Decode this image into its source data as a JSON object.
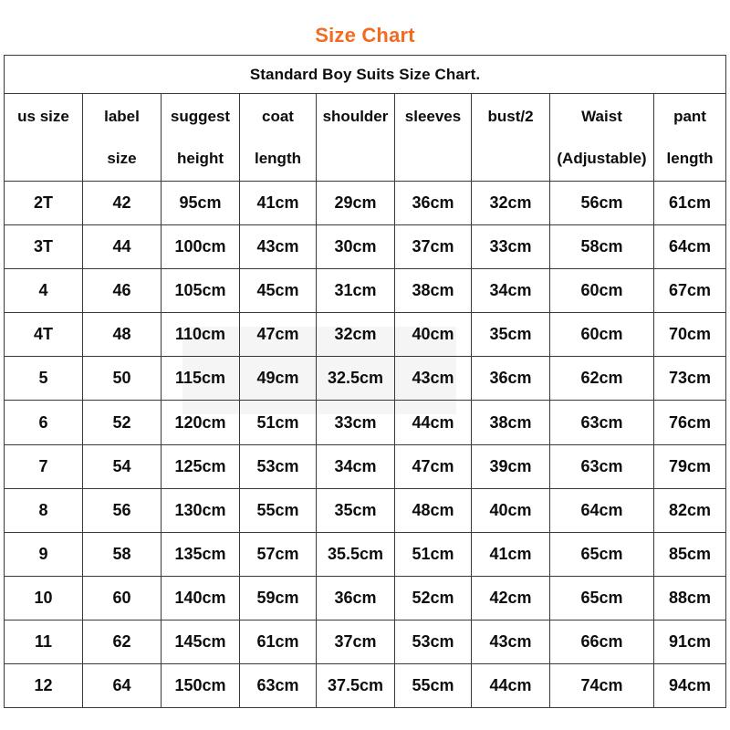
{
  "page": {
    "heading": "Size Chart",
    "heading_color": "#F26B21",
    "background_color": "#ffffff",
    "border_color": "#3a3a3a"
  },
  "table": {
    "caption": "Standard Boy Suits Size Chart.",
    "columns": [
      {
        "line1": "us size",
        "line2": ""
      },
      {
        "line1": "label",
        "line2": "size"
      },
      {
        "line1": "suggest",
        "line2": "height"
      },
      {
        "line1": "coat",
        "line2": "length"
      },
      {
        "line1": "shoulder",
        "line2": ""
      },
      {
        "line1": "sleeves",
        "line2": ""
      },
      {
        "line1": "bust/2",
        "line2": ""
      },
      {
        "line1": "Waist",
        "line2": "(Adjustable)"
      },
      {
        "line1": "pant",
        "line2": "length"
      }
    ],
    "rows": [
      [
        "2T",
        "42",
        "95cm",
        "41cm",
        "29cm",
        "36cm",
        "32cm",
        "56cm",
        "61cm"
      ],
      [
        "3T",
        "44",
        "100cm",
        "43cm",
        "30cm",
        "37cm",
        "33cm",
        "58cm",
        "64cm"
      ],
      [
        "4",
        "46",
        "105cm",
        "45cm",
        "31cm",
        "38cm",
        "34cm",
        "60cm",
        "67cm"
      ],
      [
        "4T",
        "48",
        "110cm",
        "47cm",
        "32cm",
        "40cm",
        "35cm",
        "60cm",
        "70cm"
      ],
      [
        "5",
        "50",
        "115cm",
        "49cm",
        "32.5cm",
        "43cm",
        "36cm",
        "62cm",
        "73cm"
      ],
      [
        "6",
        "52",
        "120cm",
        "51cm",
        "33cm",
        "44cm",
        "38cm",
        "63cm",
        "76cm"
      ],
      [
        "7",
        "54",
        "125cm",
        "53cm",
        "34cm",
        "47cm",
        "39cm",
        "63cm",
        "79cm"
      ],
      [
        "8",
        "56",
        "130cm",
        "55cm",
        "35cm",
        "48cm",
        "40cm",
        "64cm",
        "82cm"
      ],
      [
        "9",
        "58",
        "135cm",
        "57cm",
        "35.5cm",
        "51cm",
        "41cm",
        "65cm",
        "85cm"
      ],
      [
        "10",
        "60",
        "140cm",
        "59cm",
        "36cm",
        "52cm",
        "42cm",
        "65cm",
        "88cm"
      ],
      [
        "11",
        "62",
        "145cm",
        "61cm",
        "37cm",
        "53cm",
        "43cm",
        "66cm",
        "91cm"
      ],
      [
        "12",
        "64",
        "150cm",
        "63cm",
        "37.5cm",
        "55cm",
        "44cm",
        "74cm",
        "94cm"
      ]
    ]
  }
}
